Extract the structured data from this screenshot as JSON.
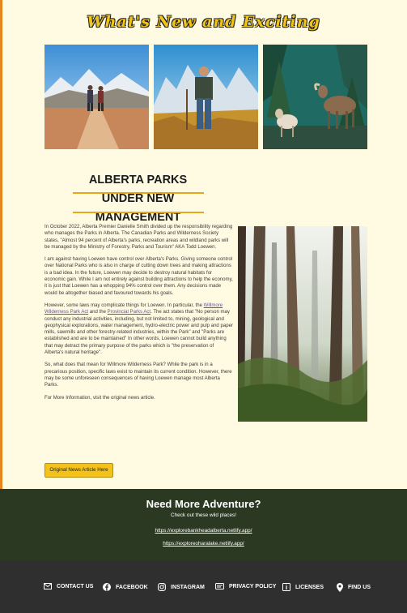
{
  "section": {
    "headline": "What's New and Exciting"
  },
  "gallery": [
    {
      "name": "hikers-photo"
    },
    {
      "name": "hiker-portrait-photo"
    },
    {
      "name": "bighorn-sheep-photo"
    }
  ],
  "article": {
    "title": "ALBERTA PARKS UNDER NEW MANAGEMENT",
    "p1": "In October 2022, Alberta Premier Danielle Smith divided up the responsibility regarding who manages the Parks in Alberta. The Canadian Parks and Wilderness Society states, \"Almost 94 percent of Alberta's parks, recreation areas and wildland parks will be managed by the Ministry of Forestry, Parks and Tourism\" AKA Todd Loewen.",
    "p2": "I am against having Loewen have control over Alberta's Parks. Giving someone control over National Parks who is also in charge of cutting down trees and making attractions is a bad idea. In the future, Loewen may decide to destroy natural habitats for economic gain. While I am not entirely against building attractions to help the economy, it is just that Loewen has a whopping 94% control over them. Any decisions made would be altogether biased and favoured towards his goals.",
    "p3_a": "However, some laws may complicate things for Loewen. In particular, the ",
    "p3_link1": "Willmore Wilderness Park Act",
    "p3_b": " and the ",
    "p3_link2": "Provincial Parks Act",
    "p3_c": ". The act states that \"No person may conduct any industrial activities, including, but not limited to, mining, geological and geophysical explorations, water management, hydro-electric power and pulp and paper mills, sawmills and other forestry-related industries, within the Park\" and \"Parks are established and are to be maintained\" In other words, Loewen cannot build anything that may detract the primary purpose of the parks which is \"the preservation of Alberta's natural heritage\".",
    "p4": "So, what does that mean for Willmore Wilderness Park? While the park is in a precarious position, specific laws exist to maintain its current condition. However, there may be some unforeseen consequences of having Loewen manage most Alberta Parks.",
    "p5": "For More Information, visit the original news article.",
    "cta": "Original News Article Here"
  },
  "adventure": {
    "title": "Need More Adventure?",
    "subtitle": "Check out these wild places!",
    "link1": "https://explorebankheadalberta.netlify.app/",
    "link2": "https://exploreoharalake.netlify.app/"
  },
  "footer": {
    "items": [
      {
        "label": "CONTACT US",
        "icon": "mail-icon"
      },
      {
        "label": "FACEBOOK",
        "icon": "facebook-icon"
      },
      {
        "label": "INSTAGRAM",
        "icon": "instagram-icon"
      },
      {
        "label": "PRIVACY POLICY",
        "icon": "privacy-card-icon"
      },
      {
        "label": "LICENSES",
        "icon": "info-icon"
      },
      {
        "label": "FIND US",
        "icon": "map-pin-icon"
      }
    ]
  },
  "colors": {
    "accent": "#f0c419",
    "dark_green": "#2b3822",
    "footer": "#2f2f2f",
    "page": "#fffbe2"
  }
}
